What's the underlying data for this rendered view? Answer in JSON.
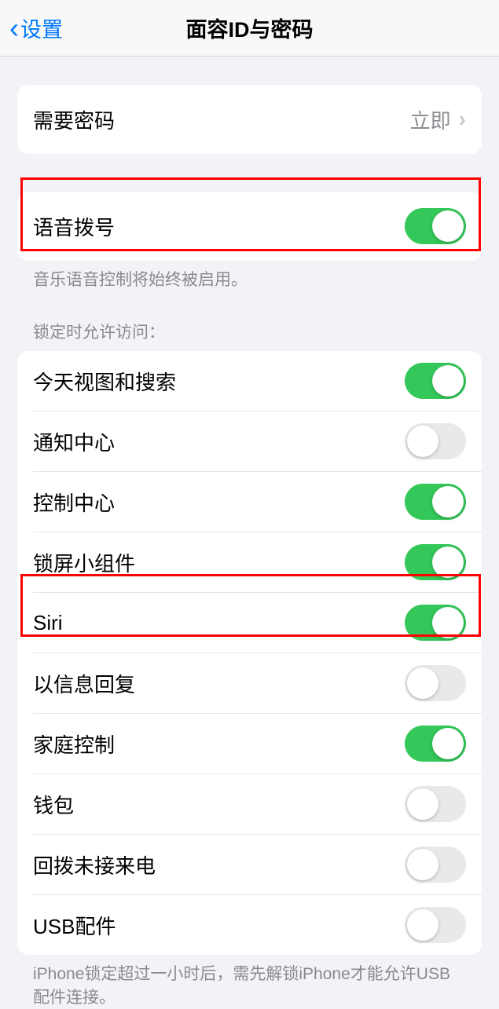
{
  "header": {
    "back_label": "设置",
    "title": "面容ID与密码"
  },
  "group1": {
    "require_passcode_label": "需要密码",
    "require_passcode_value": "立即"
  },
  "group2": {
    "voice_dial_label": "语音拨号",
    "voice_dial_on": true,
    "footer": "音乐语音控制将始终被启用。"
  },
  "group3": {
    "header": "锁定时允许访问：",
    "items": [
      {
        "label": "今天视图和搜索",
        "on": true
      },
      {
        "label": "通知中心",
        "on": false
      },
      {
        "label": "控制中心",
        "on": true
      },
      {
        "label": "锁屏小组件",
        "on": true
      },
      {
        "label": "Siri",
        "on": true
      },
      {
        "label": "以信息回复",
        "on": false
      },
      {
        "label": "家庭控制",
        "on": true
      },
      {
        "label": "钱包",
        "on": false
      },
      {
        "label": "回拨未接来电",
        "on": false
      },
      {
        "label": "USB配件",
        "on": false
      }
    ],
    "footer": "iPhone锁定超过一小时后，需先解锁iPhone才能允许USB 配件连接。"
  }
}
